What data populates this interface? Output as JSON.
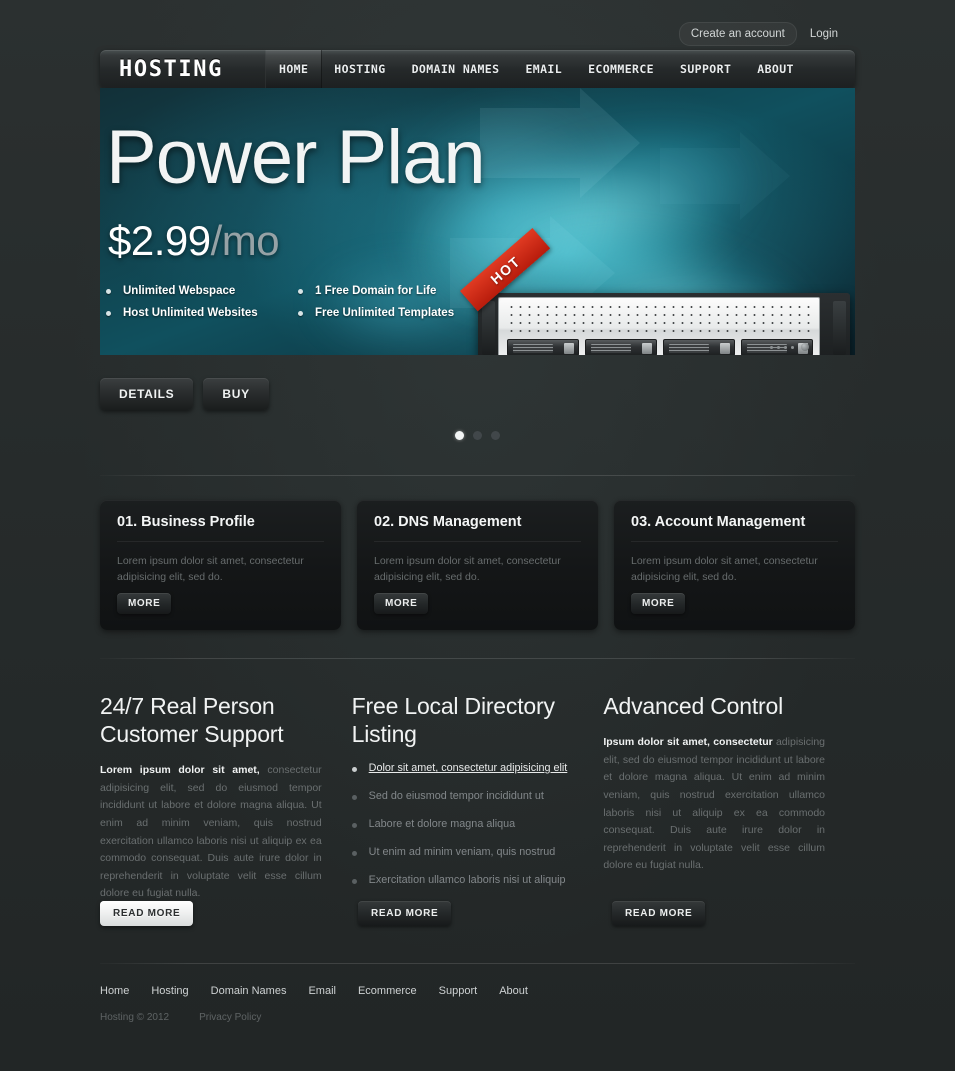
{
  "topbar": {
    "create_account": "Create an account",
    "login": "Login"
  },
  "header": {
    "logo": "HOSTING",
    "nav": [
      {
        "label": "HOME",
        "active": true
      },
      {
        "label": "HOSTING",
        "active": false
      },
      {
        "label": "DOMAIN NAMES",
        "active": false
      },
      {
        "label": "EMAIL",
        "active": false
      },
      {
        "label": "ECOMMERCE",
        "active": false
      },
      {
        "label": "SUPPORT",
        "active": false
      },
      {
        "label": "ABOUT",
        "active": false
      }
    ]
  },
  "hero": {
    "title": "Power Plan",
    "price": "$2.99",
    "per": "/mo",
    "features": [
      "Unlimited Webspace",
      "1 Free Domain for Life",
      "Host Unlimited Websites",
      "Free Unlimited Templates"
    ],
    "details_button": "DETAILS",
    "buy_button": "BUY",
    "ribbon": "HOT",
    "slide_count": 3,
    "active_slide": 1,
    "accent_color": "#3fc6dd",
    "ribbon_color": "#c82410"
  },
  "boxes": [
    {
      "title": "01. Business Profile",
      "text": "Lorem ipsum dolor sit amet, consectetur adipisicing elit, sed do.",
      "button": "MORE"
    },
    {
      "title": "02. DNS Management",
      "text": "Lorem ipsum dolor sit amet, consectetur adipisicing elit, sed do.",
      "button": "MORE"
    },
    {
      "title": "03. Account Management",
      "text": "Lorem ipsum dolor sit amet, consectetur adipisicing elit, sed do.",
      "button": "MORE"
    }
  ],
  "columns": {
    "one": {
      "heading": "24/7 Real Person Customer Support",
      "lead": "Lorem ipsum dolor sit amet,",
      "body": " consectetur adipisicing elit, sed do eiusmod tempor incididunt ut labore et dolore magna aliqua. Ut enim ad minim veniam, quis nostrud exercitation ullamco laboris nisi ut aliquip ex ea commodo consequat. Duis aute irure dolor in reprehenderit in voluptate velit esse cillum dolore eu fugiat nulla.",
      "read_more": "READ MORE"
    },
    "two": {
      "heading": "Free Local Directory Listing",
      "items": [
        "Dolor sit amet, consectetur adipisicing elit",
        "Sed do eiusmod tempor incididunt ut",
        "Labore et dolore magna aliqua",
        "Ut enim ad minim veniam, quis nostrud",
        "Exercitation ullamco laboris nisi ut aliquip"
      ],
      "read_more": "READ MORE"
    },
    "three": {
      "heading": "Advanced Control",
      "lead": "Ipsum dolor sit amet, consectetur",
      "body": " adipisicing elit, sed do eiusmod tempor incididunt ut labore et dolore magna aliqua. Ut enim ad minim veniam, quis nostrud exercitation ullamco laboris nisi ut aliquip ex ea commodo consequat. Duis aute irure dolor in reprehenderit in voluptate velit esse cillum dolore eu fugiat nulla.",
      "read_more": "READ MORE"
    }
  },
  "footer": {
    "nav": [
      "Home",
      "Hosting",
      "Domain Names",
      "Email",
      "Ecommerce",
      "Support",
      "About"
    ],
    "copyright": "Hosting © 2012",
    "privacy": "Privacy Policy"
  }
}
